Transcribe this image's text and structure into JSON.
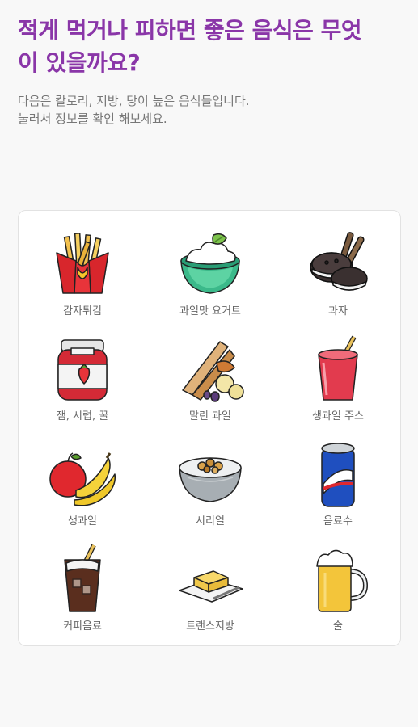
{
  "header": {
    "title": "적게 먹거나 피하면 좋은 음식은 무엇\n이 있을까요?",
    "description": "다음은 칼로리, 지방, 당이 높은 음식들입니다.\n눌러서 정보를 확인 해보세요."
  },
  "foods": [
    {
      "label": "감자튀김",
      "icon": "french-fries-icon"
    },
    {
      "label": "과일맛 요거트",
      "icon": "fruit-yogurt-icon"
    },
    {
      "label": "과자",
      "icon": "cookies-icon"
    },
    {
      "label": "잼, 시럽, 꿀",
      "icon": "jam-jar-icon"
    },
    {
      "label": "말린 과일",
      "icon": "dried-fruit-icon"
    },
    {
      "label": "생과일 주스",
      "icon": "fruit-juice-icon"
    },
    {
      "label": "생과일",
      "icon": "fresh-fruit-icon"
    },
    {
      "label": "시리얼",
      "icon": "cereal-bowl-icon"
    },
    {
      "label": "음료수",
      "icon": "soda-can-icon"
    },
    {
      "label": "커피음료",
      "icon": "coffee-drink-icon"
    },
    {
      "label": "트랜스지방",
      "icon": "butter-icon"
    },
    {
      "label": "술",
      "icon": "beer-mug-icon"
    }
  ]
}
